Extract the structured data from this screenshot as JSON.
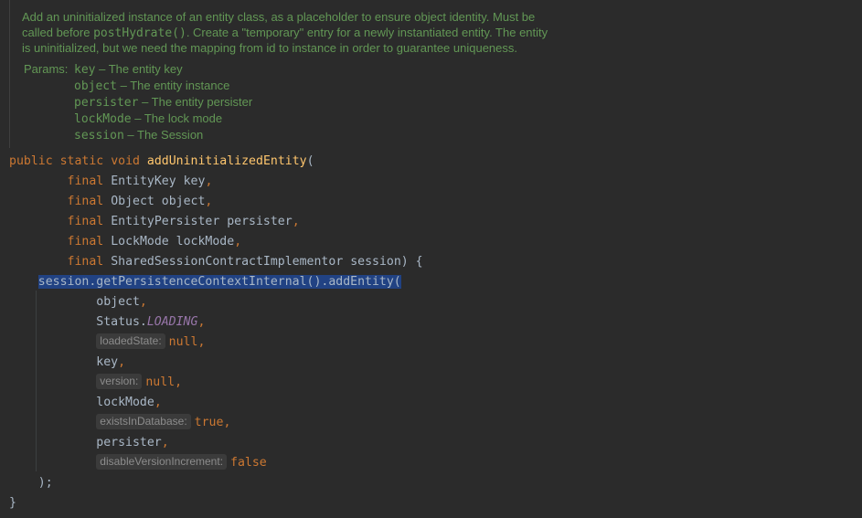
{
  "doc": {
    "line1": "Add an uninitialized instance of an entity class, as a placeholder to ensure object identity. Must be",
    "line2_prefix": "called before ",
    "line2_code": "postHydrate()",
    "line2_suffix": ". Create a \"temporary\" entry for a newly instantiated entity. The entity",
    "line3": "is uninitialized, but we need the mapping from id to instance in order to guarantee uniqueness.",
    "params_label": "Params:",
    "params": [
      {
        "name": "key",
        "desc": " – The entity key"
      },
      {
        "name": "object",
        "desc": " – The entity instance"
      },
      {
        "name": "persister",
        "desc": " – The entity persister"
      },
      {
        "name": "lockMode",
        "desc": " – The lock mode"
      },
      {
        "name": "session",
        "desc": " – The Session"
      }
    ]
  },
  "code": {
    "sig_public": "public",
    "sig_static": "static",
    "sig_void": "void",
    "method_name": "addUninitializedEntity",
    "open_paren": "(",
    "final_kw": "final",
    "args": [
      {
        "type": "EntityKey",
        "name": "key",
        "punct": ","
      },
      {
        "type": "Object",
        "name": "object",
        "punct": ","
      },
      {
        "type": "EntityPersister",
        "name": "persister",
        "punct": ","
      },
      {
        "type": "LockMode",
        "name": "lockMode",
        "punct": ","
      },
      {
        "type": "SharedSessionContractImplementor",
        "name": "session",
        "punct": ") {"
      }
    ],
    "call_line": "session.getPersistenceContextInternal().addEntity(",
    "call_args": {
      "object": "object",
      "status_class": "Status.",
      "status_const": "LOADING",
      "loaded_hint": "loadedState:",
      "loaded_val": "null",
      "key": "key",
      "version_hint": "version:",
      "version_val": "null",
      "lockMode": "lockMode",
      "exists_hint": "existsInDatabase:",
      "exists_val": "true",
      "persister": "persister",
      "disable_hint": "disableVersionIncrement:",
      "disable_val": "false"
    },
    "comma": ",",
    "close_call": ");",
    "close_brace": "}"
  }
}
